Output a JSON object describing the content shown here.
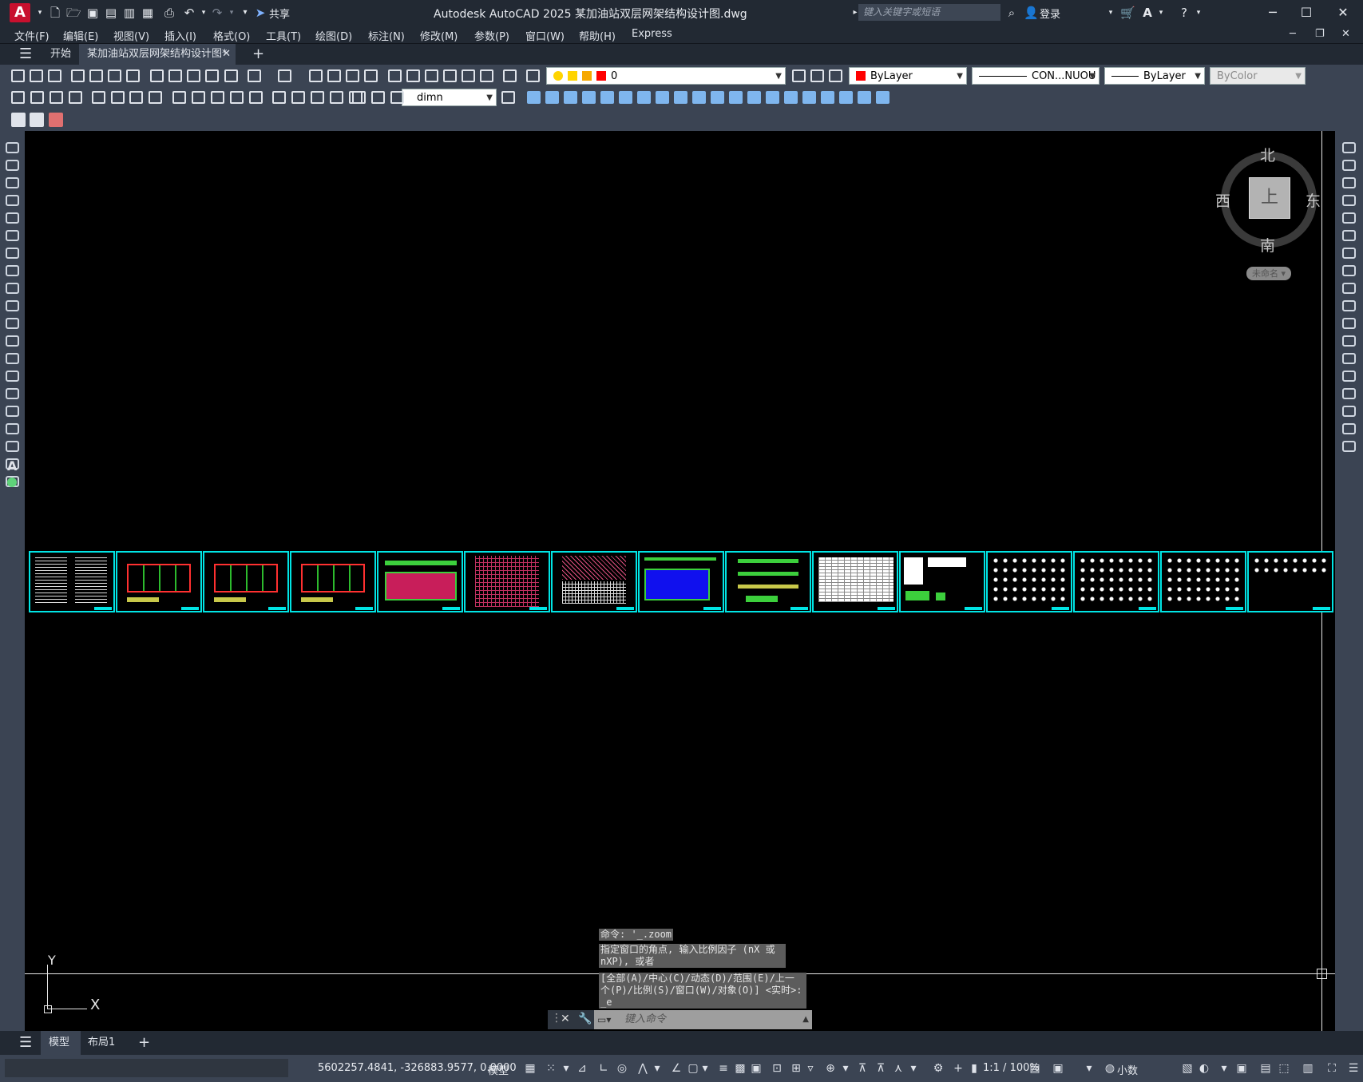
{
  "title_bar": {
    "app_icon": "A",
    "share_label": "共享",
    "title": "Autodesk AutoCAD 2025    某加油站双层网架结构设计图.dwg",
    "search_placeholder": "键入关键字或短语",
    "signin_label": "登录"
  },
  "menu": [
    "文件(F)",
    "编辑(E)",
    "视图(V)",
    "插入(I)",
    "格式(O)",
    "工具(T)",
    "绘图(D)",
    "标注(N)",
    "修改(M)",
    "参数(P)",
    "窗口(W)",
    "帮助(H)",
    "Express"
  ],
  "tabs": {
    "start": "开始",
    "document": "某加油站双层网架结构设计图*",
    "close_glyph": "✕",
    "add_glyph": "+"
  },
  "properties": {
    "layer": "0",
    "color": "ByLayer",
    "color_hex": "#ff0000",
    "linetype": "CON...NUOU",
    "lineweight": "ByLayer",
    "plotstyle": "ByColor",
    "dimstyle": "dimn"
  },
  "viewcube": {
    "north": "北",
    "south": "南",
    "east": "东",
    "west": "西",
    "face": "上",
    "wcs": "未命名"
  },
  "ucs": {
    "y": "Y",
    "x": "X"
  },
  "command": {
    "history": [
      "命令: '_.zoom",
      "指定窗口的角点, 输入比例因子 (nX 或\nnXP), 或者",
      "[全部(A)/中心(C)/动态(D)/范围(E)/上一\n个(P)/比例(S)/窗口(W)/对象(O)] <实时>:\n_e"
    ],
    "placeholder": "键入命令"
  },
  "layout_tabs": {
    "model": "模型",
    "layout1": "布局1",
    "add": "+"
  },
  "status": {
    "coords": "5602257.4841, -326883.9577, 0.0000",
    "model": "模型",
    "scale": "1:1 / 100%",
    "units": "小数"
  },
  "colors": {
    "accent_cyan": "#00e5e5",
    "titlebar": "#222933",
    "toolbar": "#3b4453"
  }
}
